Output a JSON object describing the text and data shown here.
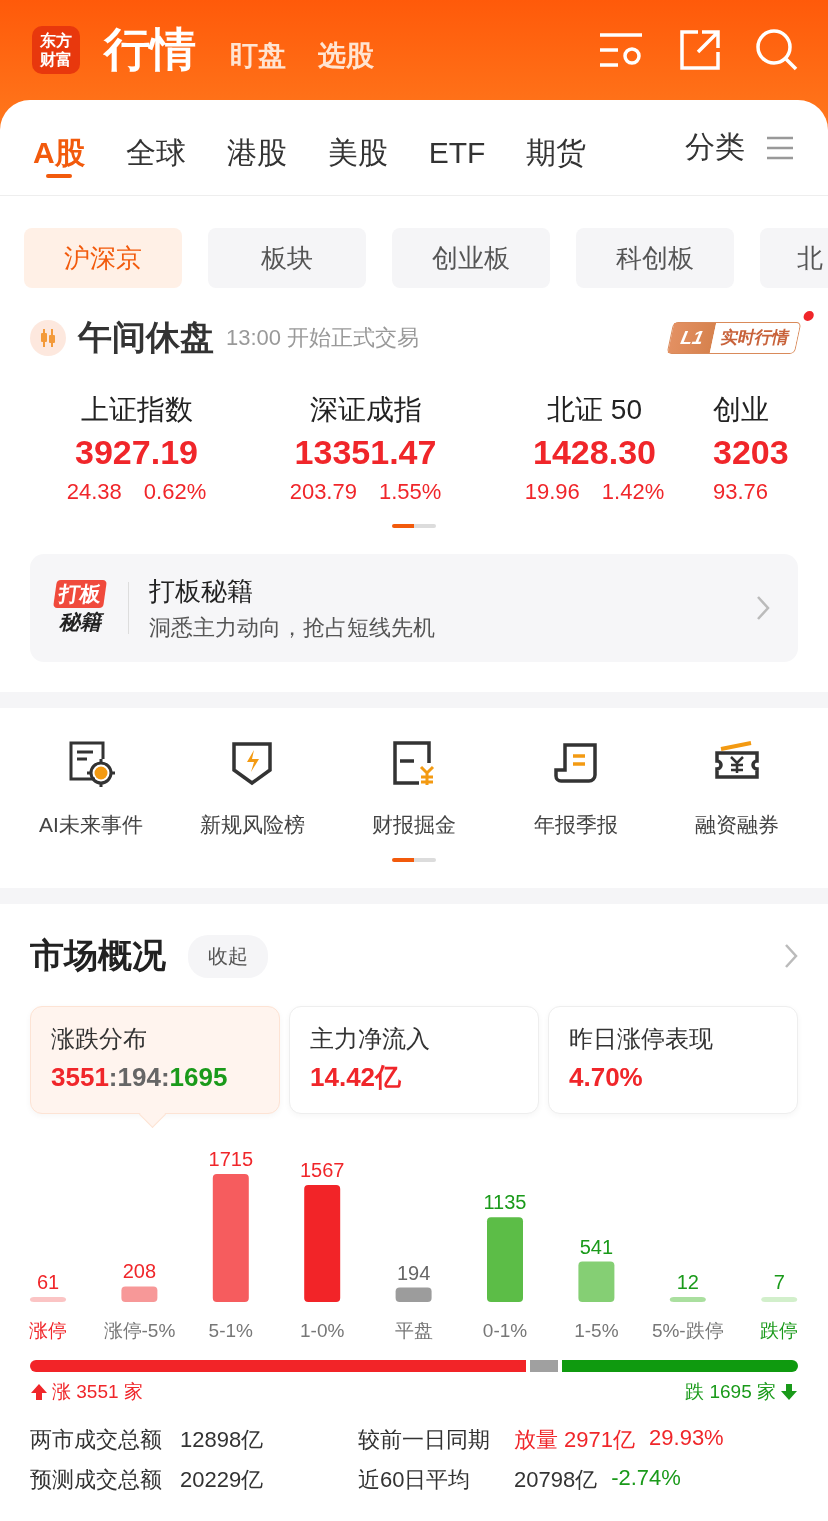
{
  "app_bar": {
    "logo": [
      "东方",
      "财富"
    ],
    "title": "行情",
    "nav": [
      {
        "label": "盯盘"
      },
      {
        "label": "选股"
      }
    ]
  },
  "market_tabs": [
    {
      "label": "A股",
      "selected": true
    },
    {
      "label": "全球",
      "selected": false
    },
    {
      "label": "港股",
      "selected": false
    },
    {
      "label": "美股",
      "selected": false
    },
    {
      "label": "ETF",
      "selected": false
    },
    {
      "label": "期货",
      "selected": false
    }
  ],
  "category_button": "分类",
  "board_chips": [
    {
      "label": "沪深京",
      "selected": true
    },
    {
      "label": "板块",
      "selected": false
    },
    {
      "label": "创业板",
      "selected": false
    },
    {
      "label": "科创板",
      "selected": false
    },
    {
      "label": "北",
      "selected": false
    }
  ],
  "session": {
    "title": "午间休盘",
    "subtitle": "13:00 开始正式交易",
    "badge_level": "L1",
    "badge_text": "实时行情",
    "notification": true
  },
  "indices": [
    {
      "name": "上证指数",
      "value": "3927.19",
      "change": "24.38",
      "percent": "0.62%"
    },
    {
      "name": "深证成指",
      "value": "13351.47",
      "change": "203.79",
      "percent": "1.55%"
    },
    {
      "name": "北证 50",
      "value": "1428.30",
      "change": "19.96",
      "percent": "1.42%"
    },
    {
      "name": "创业",
      "value": "3203",
      "change": "93.76"
    }
  ],
  "indices_pager": [
    {
      "selected": true
    },
    {
      "selected": false
    }
  ],
  "banner": {
    "logo_top": "打板",
    "logo_bottom": "秘籍",
    "title": "打板秘籍",
    "subtitle": "洞悉主力动向，抢占短线先机"
  },
  "tools": [
    {
      "label": "AI未来事件",
      "kind": "ai"
    },
    {
      "label": "新规风险榜",
      "kind": "shield"
    },
    {
      "label": "财报掘金",
      "kind": "report"
    },
    {
      "label": "年报季报",
      "kind": "scroll"
    },
    {
      "label": "融资融券",
      "kind": "ticket"
    }
  ],
  "tools_pager": [
    {
      "selected": true
    },
    {
      "selected": false
    }
  ],
  "overview": {
    "title": "市场概况",
    "collapse_button": "收起",
    "cards": [
      {
        "label": "涨跌分布",
        "selected": true,
        "parts": [
          {
            "text": "3551",
            "color": "#f0262a"
          },
          {
            "text": ":194:",
            "color": "#666666"
          },
          {
            "text": "1695",
            "color": "#1a9a1a"
          }
        ]
      },
      {
        "label": "主力净流入",
        "selected": false,
        "parts": [
          {
            "text": "14.42亿",
            "color": "#f0262a"
          }
        ]
      },
      {
        "label": "昨日涨停表现",
        "selected": false,
        "parts": [
          {
            "text": "4.70%",
            "color": "#f0262a"
          }
        ]
      }
    ],
    "distribution": {
      "chart_data": {
        "type": "bar",
        "categories": [
          "涨停",
          "涨停-5%",
          "5-1%",
          "1-0%",
          "平盘",
          "0-1%",
          "1-5%",
          "5%-跌停",
          "跌停"
        ],
        "values": [
          61,
          208,
          1715,
          1567,
          194,
          1135,
          541,
          12,
          7
        ],
        "data_labels": true
      },
      "bars": [
        {
          "color": "#fbc4c4"
        },
        {
          "color": "#f79898"
        },
        {
          "color": "#f65c5e"
        },
        {
          "color": "#f22428"
        },
        {
          "color": "#9c9c9c"
        },
        {
          "color": "#5cbd47"
        },
        {
          "color": "#85cf74"
        },
        {
          "color": "#aadf9f"
        },
        {
          "color": "#d2efcb"
        }
      ]
    },
    "split": [
      {
        "color": "#f22428"
      },
      {
        "color": "#a0a0a0"
      },
      {
        "color": "#0f9a0f"
      }
    ],
    "rise_label": "涨 3551 家",
    "fall_label": "跌 1695 家",
    "stats": [
      {
        "label": "两市成交总额",
        "value": "12898亿",
        "compare_label": "较前一日同期",
        "compare": [
          {
            "text": "放量 2971亿",
            "color": "#f0262a"
          },
          {
            "text": "29.93%",
            "color": "#f0262a"
          }
        ]
      },
      {
        "label": "预测成交总额",
        "value": "20229亿",
        "compare_label": "近60日平均",
        "compare": [
          {
            "text": "20798亿",
            "color": "#333333"
          },
          {
            "text": "-2.74%",
            "color": "#1a9a1a"
          }
        ]
      }
    ]
  }
}
